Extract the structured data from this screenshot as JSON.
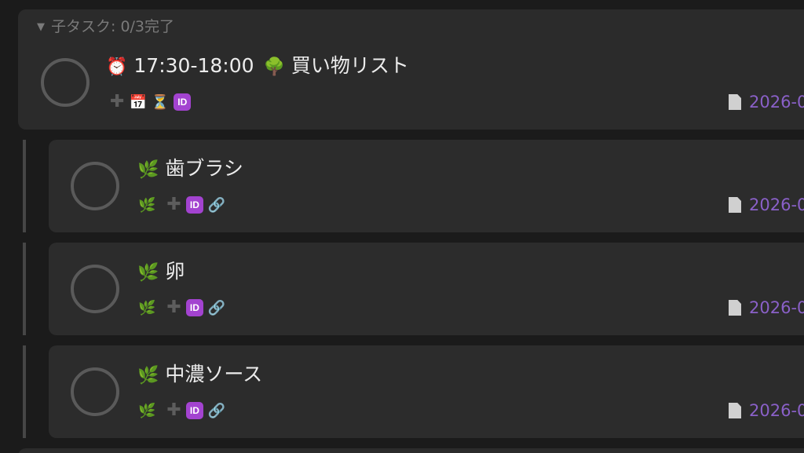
{
  "section": {
    "toggle_icon": "▼",
    "label": "子タスク: 0/3完了"
  },
  "parent_task": {
    "time_icon": "⏰",
    "time": "17:30-18:00",
    "tree_icon": "🌳",
    "title": "買い物リスト",
    "plus": "✚",
    "calendar_icon": "📅",
    "hourglass_icon": "⏳",
    "id_badge": "ID",
    "date": "2026-0"
  },
  "child_tasks": [
    {
      "herb_icon": "🌿",
      "title": "歯ブラシ",
      "meta_herb_icon": "🌿",
      "plus": "✚",
      "id_badge": "ID",
      "link_icon": "🔗",
      "date": "2026-0"
    },
    {
      "herb_icon": "🌿",
      "title": "卵",
      "meta_herb_icon": "🌿",
      "plus": "✚",
      "id_badge": "ID",
      "link_icon": "🔗",
      "date": "2026-0"
    },
    {
      "herb_icon": "🌿",
      "title": "中濃ソース",
      "meta_herb_icon": "🌿",
      "plus": "✚",
      "id_badge": "ID",
      "link_icon": "🔗",
      "date": "2026-0"
    }
  ],
  "colors": {
    "background": "#1b1b1b",
    "card": "#2b2b2b",
    "date_accent": "#8a60c8",
    "id_badge": "#a343d0"
  }
}
